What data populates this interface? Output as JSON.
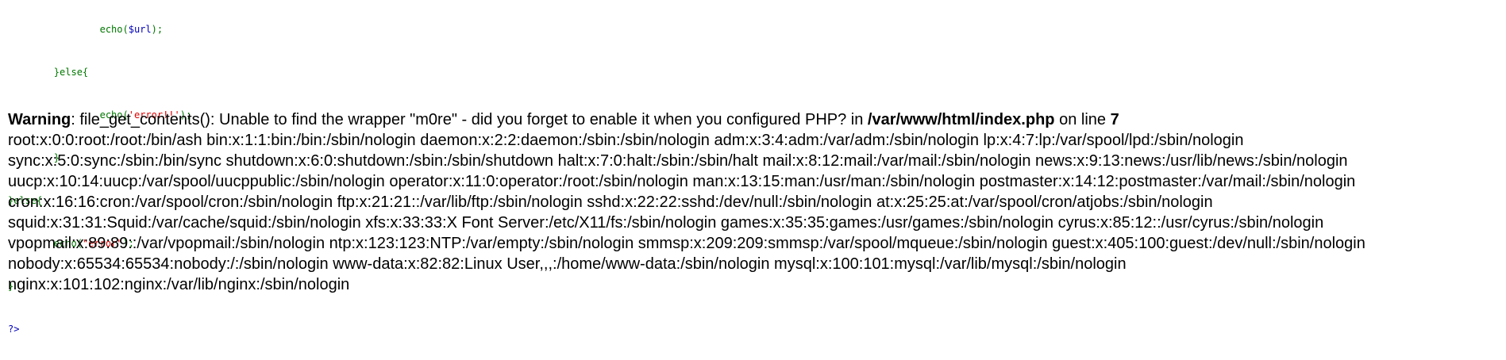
{
  "code": {
    "line1": {
      "fn": "echo(",
      "var": "$url",
      "end": ");"
    },
    "line2": {
      "text": "}else{"
    },
    "line3": {
      "fn": "echo(",
      "str": "'error!!'",
      "end": ");"
    },
    "line4": {
      "text": "}"
    },
    "line5": {
      "text": "}else{"
    },
    "line6": {
      "fn": "echo(",
      "str": "\"error\"",
      "end": ");"
    },
    "line7": {
      "text": "}"
    },
    "line8": {
      "text": "?>"
    }
  },
  "warning": {
    "label": "Warning",
    "message": ": file_get_contents(): Unable to find the wrapper \"m0re\" - did you forget to enable it when you configured PHP? in ",
    "file": "/var/www/html/index.php",
    "on_line_text": " on line ",
    "line_number": "7"
  },
  "output_lines": [
    "root:x:0:0:root:/root:/bin/ash bin:x:1:1:bin:/bin:/sbin/nologin daemon:x:2:2:daemon:/sbin:/sbin/nologin adm:x:3:4:adm:/var/adm:/sbin/nologin lp:x:4:7:lp:/var/spool/lpd:/sbin/nologin",
    "sync:x:5:0:sync:/sbin:/bin/sync shutdown:x:6:0:shutdown:/sbin:/sbin/shutdown halt:x:7:0:halt:/sbin:/sbin/halt mail:x:8:12:mail:/var/mail:/sbin/nologin news:x:9:13:news:/usr/lib/news:/sbin/nologin",
    "uucp:x:10:14:uucp:/var/spool/uucppublic:/sbin/nologin operator:x:11:0:operator:/root:/sbin/nologin man:x:13:15:man:/usr/man:/sbin/nologin postmaster:x:14:12:postmaster:/var/mail:/sbin/nologin",
    "cron:x:16:16:cron:/var/spool/cron:/sbin/nologin ftp:x:21:21::/var/lib/ftp:/sbin/nologin sshd:x:22:22:sshd:/dev/null:/sbin/nologin at:x:25:25:at:/var/spool/cron/atjobs:/sbin/nologin",
    "squid:x:31:31:Squid:/var/cache/squid:/sbin/nologin xfs:x:33:33:X Font Server:/etc/X11/fs:/sbin/nologin games:x:35:35:games:/usr/games:/sbin/nologin cyrus:x:85:12::/usr/cyrus:/sbin/nologin",
    "vpopmail:x:89:89::/var/vpopmail:/sbin/nologin ntp:x:123:123:NTP:/var/empty:/sbin/nologin smmsp:x:209:209:smmsp:/var/spool/mqueue:/sbin/nologin guest:x:405:100:guest:/dev/null:/sbin/nologin",
    "nobody:x:65534:65534:nobody:/:/sbin/nologin www-data:x:82:82:Linux User,,,:/home/www-data:/sbin/nologin mysql:x:100:101:mysql:/var/lib/mysql:/sbin/nologin",
    "nginx:x:101:102:nginx:/var/lib/nginx:/sbin/nologin"
  ],
  "colors": {
    "keyword": "#007700",
    "string": "#DD0000",
    "variable": "#0000BB",
    "text": "#000000",
    "background": "#FFFFFF"
  }
}
